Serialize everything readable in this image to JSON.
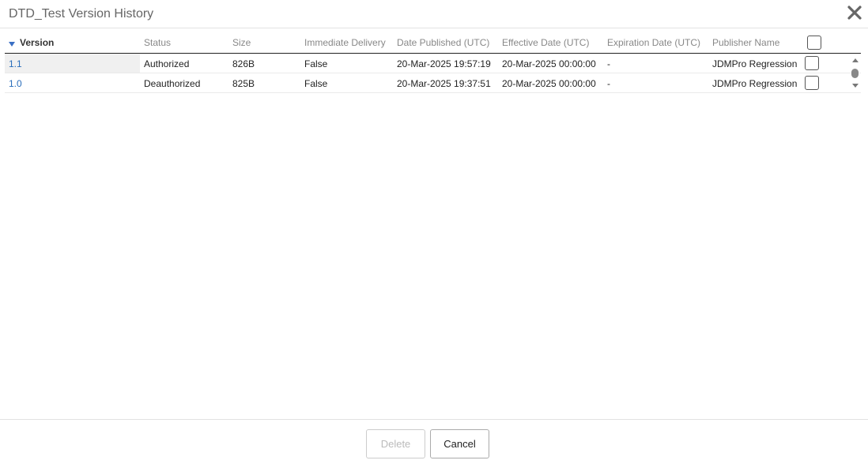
{
  "dialog": {
    "title": "DTD_Test Version History"
  },
  "table": {
    "columns": [
      {
        "label": "Version"
      },
      {
        "label": "Status"
      },
      {
        "label": "Size"
      },
      {
        "label": "Immediate Delivery"
      },
      {
        "label": "Date Published (UTC)"
      },
      {
        "label": "Effective Date (UTC)"
      },
      {
        "label": "Expiration Date (UTC)"
      },
      {
        "label": "Publisher Name"
      }
    ],
    "rows": [
      {
        "version": "1.1",
        "status": "Authorized",
        "size": "826B",
        "immediate_delivery": "False",
        "date_published": "20-Mar-2025 19:57:19",
        "effective_date": "20-Mar-2025 00:00:00",
        "expiration_date": "-",
        "publisher_name": "JDMPro Regression Test"
      },
      {
        "version": "1.0",
        "status": "Deauthorized",
        "size": "825B",
        "immediate_delivery": "False",
        "date_published": "20-Mar-2025 19:37:51",
        "effective_date": "20-Mar-2025 00:00:00",
        "expiration_date": "-",
        "publisher_name": "JDMPro Regression Test"
      }
    ]
  },
  "footer": {
    "delete_label": "Delete",
    "cancel_label": "Cancel"
  },
  "icons": {
    "close": "close-icon",
    "sort": "sort-desc-icon"
  }
}
